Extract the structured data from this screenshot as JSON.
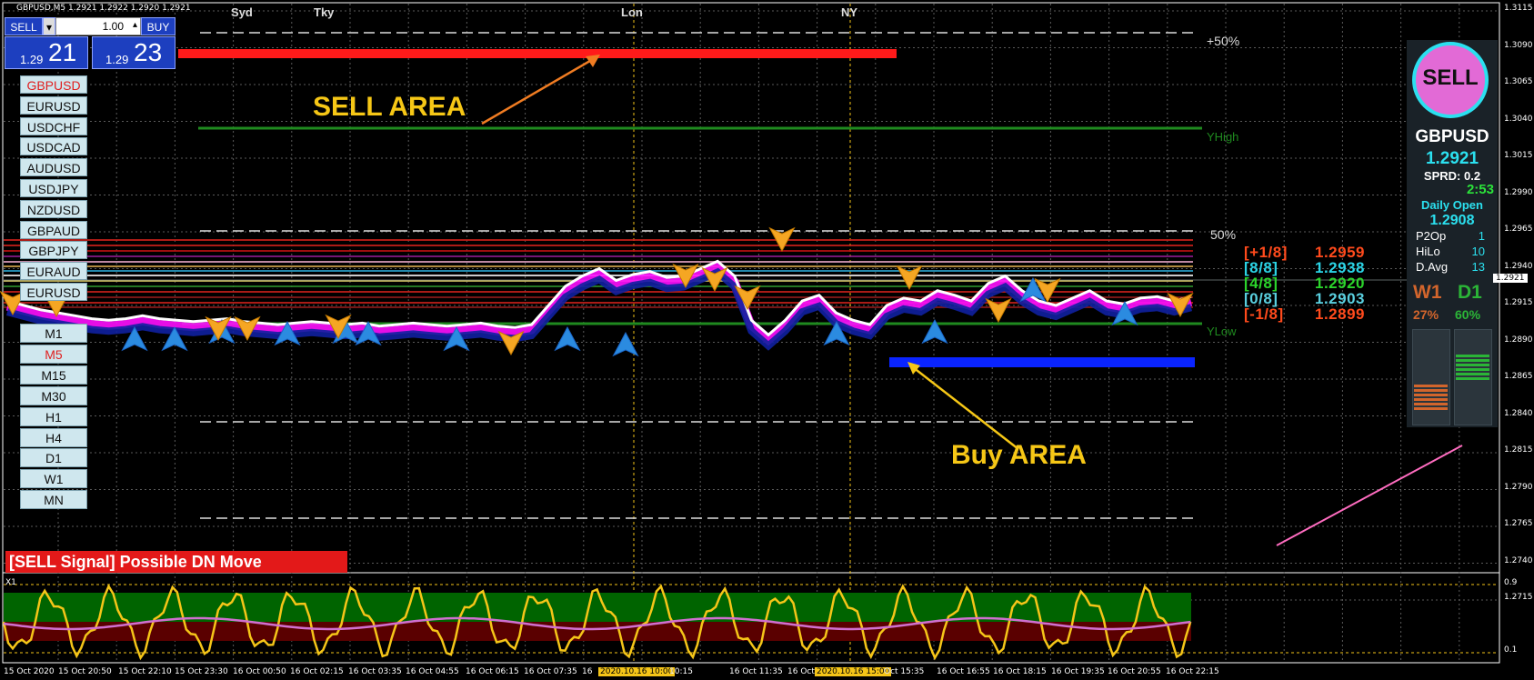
{
  "chart_title": "GBPUSD,M5  1.2921 1.2922 1.2920 1.2921",
  "trade_panel": {
    "sell_label": "SELL",
    "buy_label": "BUY",
    "lot": "1.00",
    "sell_price_prefix": "1.29",
    "sell_price_big": "21",
    "buy_price_prefix": "1.29",
    "buy_price_big": "23"
  },
  "symbols": [
    "GBPUSD",
    "EURUSD",
    "USDCHF",
    "USDCAD",
    "AUDUSD",
    "USDJPY",
    "NZDUSD",
    "GBPAUD",
    "GBPJPY",
    "EURAUD",
    "EURUSD"
  ],
  "active_symbol_index": 0,
  "timeframes": [
    "M1",
    "M5",
    "M15",
    "M30",
    "H1",
    "H4",
    "D1",
    "W1",
    "MN"
  ],
  "active_timeframe_index": 1,
  "sessions": [
    "Syd",
    "Tky",
    "Lon",
    "NY"
  ],
  "annotations": {
    "sell_area": "SELL AREA",
    "buy_area": "Buy AREA",
    "plus50": "+50%",
    "fifty": "50%",
    "yhigh": "YHigh",
    "ylow": "YLow"
  },
  "signal_text": "[SELL Signal] Possible DN Move",
  "dashboard": {
    "signal": "SELL",
    "symbol": "GBPUSD",
    "price": "1.2921",
    "spread": "SPRD: 0.2",
    "timer": "2:53",
    "daily_open_label": "Daily Open",
    "daily_open": "1.2908",
    "stats": [
      {
        "label": "P2Op",
        "value": "1"
      },
      {
        "label": "HiLo",
        "value": "10"
      },
      {
        "label": "D.Avg",
        "value": "13"
      }
    ],
    "w1_label": "W1",
    "d1_label": "D1",
    "w1_pct": "27%",
    "d1_pct": "60%",
    "w1_level": 0.27,
    "d1_level": 0.6
  },
  "levels": [
    {
      "tag": "[+1/8]",
      "price": "1.2959",
      "color": "#ff4a1c"
    },
    {
      "tag": "[8/8]",
      "price": "1.2938",
      "color": "#2bd4e6"
    },
    {
      "tag": "[4/8]",
      "price": "1.2920",
      "color": "#2bd42b"
    },
    {
      "tag": "[0/8]",
      "price": "1.2903",
      "color": "#5ad0e0"
    },
    {
      "tag": "[-1/8]",
      "price": "1.2899",
      "color": "#ff4a1c"
    }
  ],
  "current_price_tag": "1.2921",
  "price_axis": [
    "1.3115",
    "1.3090",
    "1.3065",
    "1.3040",
    "1.3015",
    "1.2990",
    "1.2965",
    "1.2940",
    "1.2915",
    "1.2890",
    "1.2865",
    "1.2840",
    "1.2815",
    "1.2790",
    "1.2765",
    "1.2740",
    "1.2715"
  ],
  "osc_axis": [
    "0.9",
    "0.1"
  ],
  "osc_label": "X1",
  "time_axis": [
    {
      "t": "15 Oct 2020",
      "hl": false
    },
    {
      "t": "15 Oct 20:50",
      "hl": false
    },
    {
      "t": "15 Oct 22:10",
      "hl": false
    },
    {
      "t": "15 Oct 23:30",
      "hl": false
    },
    {
      "t": "16 Oct 00:50",
      "hl": false
    },
    {
      "t": "16 Oct 02:15",
      "hl": false
    },
    {
      "t": "16 Oct 03:35",
      "hl": false
    },
    {
      "t": "16 Oct 04:55",
      "hl": false
    },
    {
      "t": "16 Oct 06:15",
      "hl": false
    },
    {
      "t": "16 Oct 07:35",
      "hl": false
    },
    {
      "t": "16",
      "hl": false
    },
    {
      "t": "2020.10.16 10:00",
      "hl": true
    },
    {
      "t": "10:15",
      "hl": false
    },
    {
      "t": "16 Oct 11:35",
      "hl": false
    },
    {
      "t": "16 Oct 12:55",
      "hl": false
    },
    {
      "t": "2020.10.16 15:00",
      "hl": true
    },
    {
      "t": "Oct 15:35",
      "hl": false
    },
    {
      "t": "16 Oct 16:55",
      "hl": false
    },
    {
      "t": "16 Oct 18:15",
      "hl": false
    },
    {
      "t": "16 Oct 19:35",
      "hl": false
    },
    {
      "t": "16 Oct 20:55",
      "hl": false
    },
    {
      "t": "16 Oct 22:15",
      "hl": false
    }
  ],
  "chart_data": {
    "type": "line",
    "price_series": [
      1.2918,
      1.2915,
      1.2912,
      1.291,
      1.2908,
      1.2906,
      1.2905,
      1.2906,
      1.2908,
      1.2906,
      1.2905,
      1.2904,
      1.2905,
      1.2906,
      1.2904,
      1.2903,
      1.2902,
      1.2903,
      1.2904,
      1.2903,
      1.2902,
      1.2903,
      1.2901,
      1.2902,
      1.2903,
      1.2902,
      1.2901,
      1.2902,
      1.2903,
      1.2901,
      1.29,
      1.2902,
      1.2915,
      1.2928,
      1.2935,
      1.294,
      1.2932,
      1.2936,
      1.2938,
      1.2934,
      1.2935,
      1.294,
      1.2945,
      1.2935,
      1.2905,
      1.2895,
      1.2905,
      1.2918,
      1.2922,
      1.291,
      1.2905,
      1.2902,
      1.2915,
      1.292,
      1.2918,
      1.2925,
      1.2922,
      1.2918,
      1.293,
      1.2935,
      1.2925,
      1.2918,
      1.2915,
      1.292,
      1.2925,
      1.2918,
      1.2916,
      1.292,
      1.2921,
      1.2918,
      1.2921
    ],
    "ylim": [
      1.2705,
      1.312
    ]
  }
}
